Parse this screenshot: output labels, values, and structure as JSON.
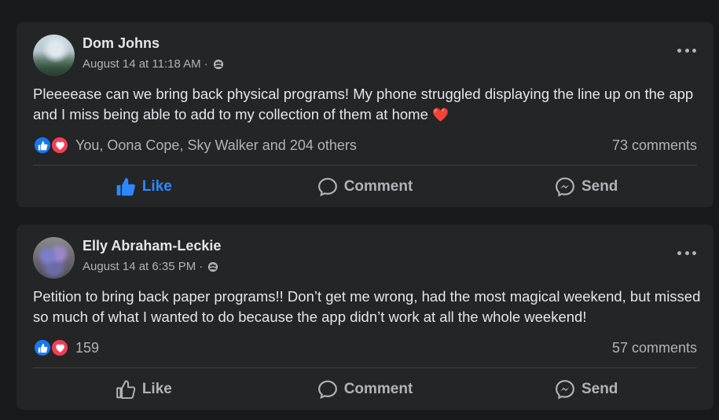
{
  "posts": [
    {
      "author": "Dom Johns",
      "timestamp": "August 14 at 11:18 AM",
      "separator": "·",
      "privacy_icon": "groups-icon",
      "text": "Pleeeease can we bring back physical programs! My phone struggled displaying the line up on the app and I miss being able to add to my collection of them at home",
      "emoji": "❤️",
      "reaction_icons": [
        "like-reaction-icon",
        "love-reaction-icon"
      ],
      "reactions_text": "You, Oona Cope, Sky Walker and 204 others",
      "comments": "73 comments",
      "liked": true,
      "actions": {
        "like": "Like",
        "comment": "Comment",
        "send": "Send"
      }
    },
    {
      "author": "Elly Abraham-Leckie",
      "timestamp": "August 14 at 6:35 PM",
      "separator": "·",
      "privacy_icon": "groups-icon",
      "text": "Petition to bring back paper programs!! Don’t get me wrong, had the most magical weekend, but missed so much of what I wanted to do because the app didn’t work at all the whole weekend!",
      "emoji": "",
      "reaction_icons": [
        "like-reaction-icon",
        "love-reaction-icon"
      ],
      "reactions_text": "159",
      "comments": "57 comments",
      "liked": false,
      "actions": {
        "like": "Like",
        "comment": "Comment",
        "send": "Send"
      }
    }
  ],
  "colors": {
    "background": "#18191a",
    "card": "#242526",
    "primary_text": "#e4e6eb",
    "secondary_text": "#b0b3b8",
    "accent_blue": "#2d88ff",
    "like_blue": "#1877f2",
    "love_red": "#f33e58"
  }
}
